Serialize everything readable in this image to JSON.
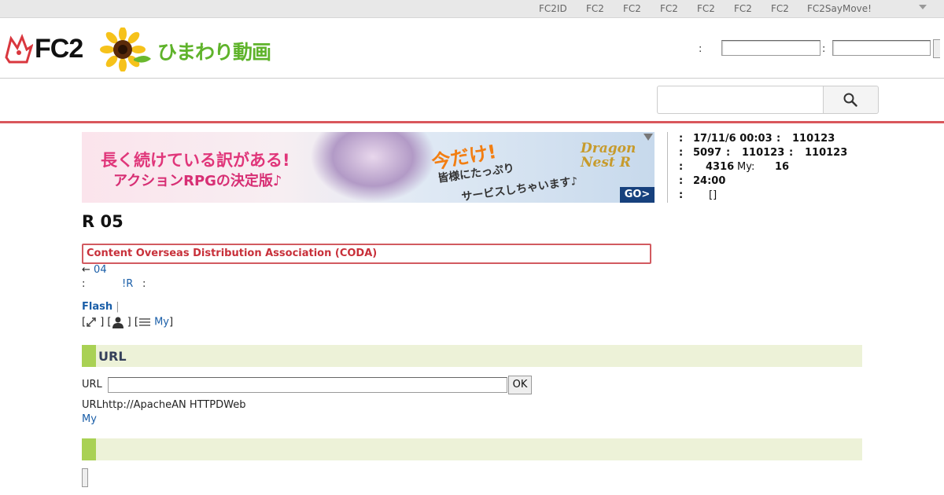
{
  "topnav": {
    "items": [
      "FC2ID",
      "FC2",
      "FC2",
      "FC2",
      "FC2",
      "FC2",
      "FC2",
      "FC2SayMove!"
    ]
  },
  "header": {
    "logo_text": "FC2",
    "logo_sub": "ひまわり動画",
    "login_colon_1": ":",
    "login_colon_2": ":"
  },
  "banner": {
    "line1": "長く続けている訳がある!",
    "line2": "アクションRPGの決定版♪",
    "line3": "今だけ!",
    "line4": "皆様にたっぷり",
    "line5": "サービスしちゃいます♪",
    "brand1": "Dragon",
    "brand2": "Nest R",
    "go": "GO>"
  },
  "info": {
    "rows": [
      [
        ":",
        "17/11/6 00:03",
        ":",
        "110123"
      ],
      [
        ":",
        "5097",
        ":",
        "110123",
        ":",
        "110123"
      ],
      [
        ":",
        "4316",
        "My:",
        "16"
      ],
      [
        ":",
        "24:00"
      ],
      [
        ":",
        "[]"
      ]
    ]
  },
  "main": {
    "title": "R 05",
    "coda": "Content Overseas Distribution Association (CODA)",
    "prev_arrow": "←",
    "prev_link": "04",
    "meta_colon_1": ":",
    "meta_link": "!R",
    "meta_colon_2": ":",
    "flash_label": "Flash",
    "flash_sep": "|",
    "my_link": "My"
  },
  "url_section": {
    "heading": "URL",
    "input_label": "URL",
    "ok": "OK",
    "description": "URLhttp://ApacheAN HTTPDWeb",
    "my_link": "My"
  },
  "colors": {
    "accent_red": "#d9575c",
    "section_green": "#a9d154",
    "section_bg": "#edf2d8",
    "link_blue": "#1a5ea8"
  }
}
